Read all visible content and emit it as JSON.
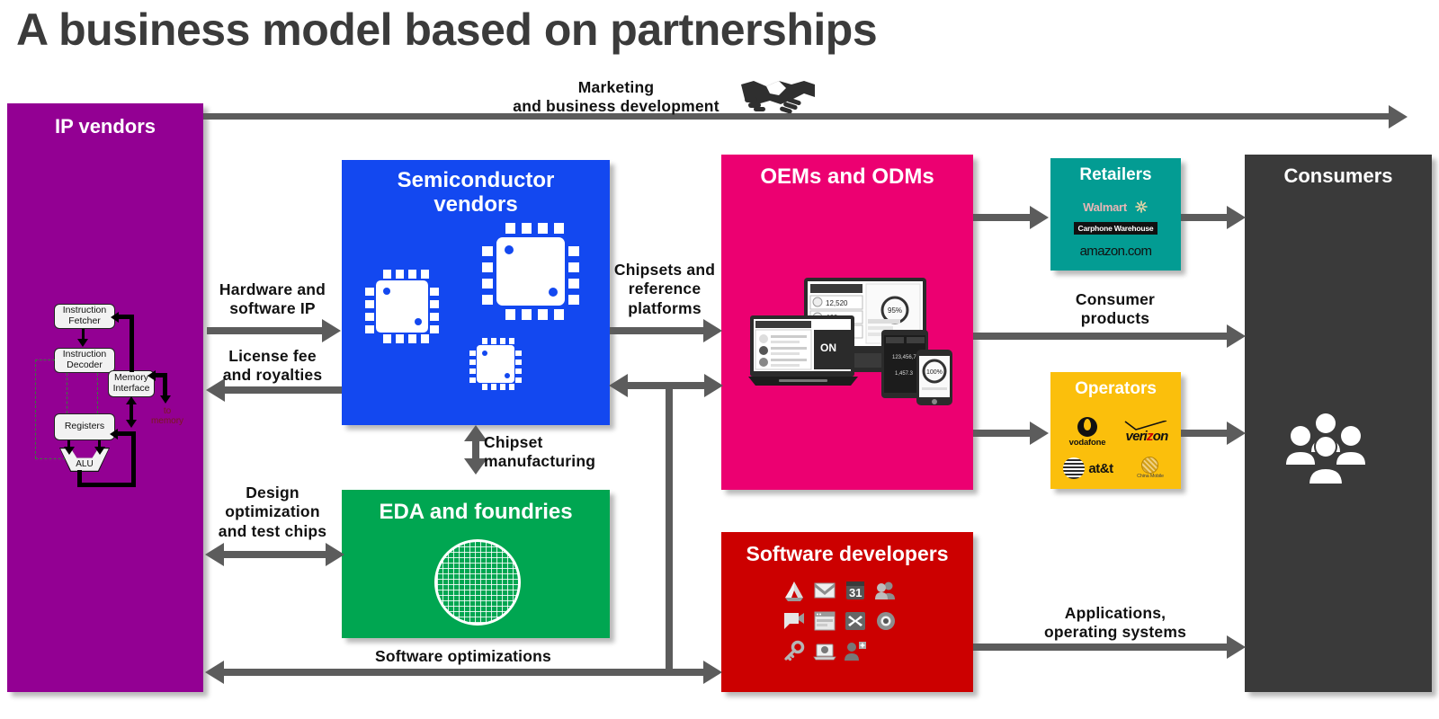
{
  "page": {
    "title": "A business model based on partnerships",
    "background": "#ffffff"
  },
  "colors": {
    "ip_vendors": "#930093",
    "semiconductor_vendors": "#1348f0",
    "eda_foundries": "#00a651",
    "oems_odms": "#ec0071",
    "software_developers": "#cc0000",
    "retailers": "#039c93",
    "operators": "#fbbf0c",
    "consumers": "#3a3a3a",
    "arrow": "#5c5c5c",
    "label_text": "#111111",
    "title_text": "#3b3b3b"
  },
  "boxes": {
    "ip_vendors": {
      "label": "IP vendors"
    },
    "semiconductor_vendors": {
      "label": "Semiconductor\nvendors"
    },
    "eda_foundries": {
      "label": "EDA and foundries"
    },
    "oems_odms": {
      "label": "OEMs and ODMs"
    },
    "software_developers": {
      "label": "Software developers"
    },
    "retailers": {
      "label": "Retailers"
    },
    "operators": {
      "label": "Operators"
    },
    "consumers": {
      "label": "Consumers"
    }
  },
  "flows": {
    "marketing": "Marketing\nand business development",
    "hardware_software_ip": "Hardware  and\nsoftware IP",
    "license_fee": "License fee\nand royalties",
    "chipsets_reference": "Chipsets  and\nreference\nplatforms",
    "chipset_manufacturing": "Chipset\nmanufacturing",
    "design_optimization": "Design\noptimization\nand test chips",
    "software_optimizations": "Software  optimizations",
    "consumer_products": "Consumer\nproducts",
    "applications_os": "Applications,\noperating systems"
  },
  "cpu_diagram": {
    "instruction_fetcher": "Instruction\nFetcher",
    "instruction_decoder": "Instruction\nDecoder",
    "memory_interface": "Memory\nInterface",
    "registers": "Registers",
    "alu": "ALU",
    "to_memory": "to\nmemory"
  },
  "retailer_logos": [
    {
      "name": "walmart",
      "text": "Walmart"
    },
    {
      "name": "carphone-warehouse",
      "text": "Carphone Warehouse"
    },
    {
      "name": "amazon",
      "text": "amazon",
      "suffix": ".com"
    }
  ],
  "operator_logos": [
    {
      "name": "vodafone",
      "text": "vodafone"
    },
    {
      "name": "verizon",
      "text": "veri",
      "accent": "z",
      "tail": "on"
    },
    {
      "name": "att",
      "text": "at&t"
    },
    {
      "name": "china-mobile",
      "text": "China Mobile"
    }
  ],
  "software_icons": [
    "drive-icon",
    "gmail-icon",
    "calendar-icon",
    "contacts-icon",
    "hangouts-icon",
    "sites-icon",
    "admin-icon",
    "chrome-icon",
    "key-icon",
    "laptop-icon",
    "add-person-icon"
  ],
  "icons": {
    "handshake": "handshake-icon",
    "people": "people-group-icon",
    "wafer": "silicon-wafer-icon",
    "chips": [
      "chip-icon-medium",
      "chip-icon-large",
      "chip-icon-small"
    ],
    "devices": "multi-device-illustration"
  }
}
